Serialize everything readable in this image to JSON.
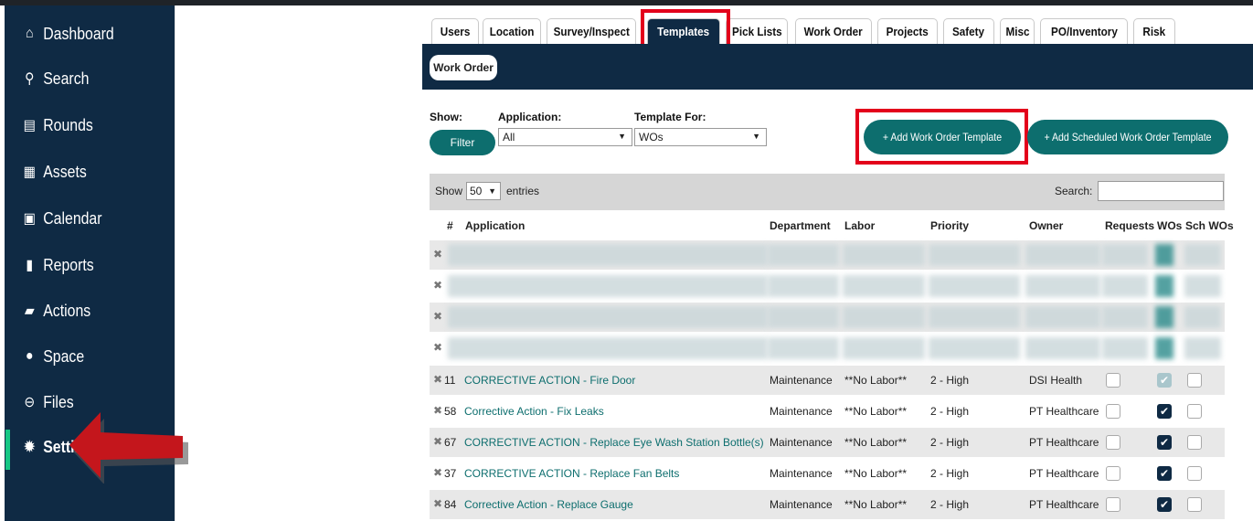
{
  "sidebar": {
    "items": [
      {
        "label": "Dashboard",
        "icon": "home-icon",
        "glyph": "⌂"
      },
      {
        "label": "Search",
        "icon": "search-icon",
        "glyph": "⚲"
      },
      {
        "label": "Rounds",
        "icon": "clipboard-icon",
        "glyph": "▤"
      },
      {
        "label": "Assets",
        "icon": "boxes-icon",
        "glyph": "▦"
      },
      {
        "label": "Calendar",
        "icon": "calendar-icon",
        "glyph": "▣"
      },
      {
        "label": "Reports",
        "icon": "bar-chart-icon",
        "glyph": "▮"
      },
      {
        "label": "Actions",
        "icon": "folder-icon",
        "glyph": "▰"
      },
      {
        "label": "Space",
        "icon": "map-pin-icon",
        "glyph": "●"
      },
      {
        "label": "Files",
        "icon": "link-icon",
        "glyph": "⊖"
      },
      {
        "label": "Settings",
        "icon": "gear-icon",
        "glyph": "✹"
      }
    ]
  },
  "tabs": [
    "Users",
    "Location",
    "Survey/Inspect",
    "Templates",
    "Pick Lists",
    "Work Order",
    "Projects",
    "Safety",
    "Misc",
    "PO/Inventory",
    "Risk"
  ],
  "active_tab": "Templates",
  "subtab": "Work Order",
  "filters": {
    "show_label": "Show:",
    "filter_button": "Filter",
    "application_label": "Application:",
    "application_value": "All",
    "template_for_label": "Template For:",
    "template_for_value": "WOs"
  },
  "buttons": {
    "add_wo_template": "+ Add Work Order Template",
    "add_scheduled_wo_template": "+ Add Scheduled Work Order Template"
  },
  "table_controls": {
    "show": "Show",
    "entries_value": "50",
    "entries": "entries",
    "search_label": "Search:"
  },
  "columns": [
    "#",
    "Application",
    "Department",
    "Labor",
    "Priority",
    "Owner",
    "Requests",
    "WOs",
    "Sch WOs"
  ],
  "rows": [
    {
      "num": "11",
      "application": "CORRECTIVE ACTION - Fire Door",
      "department": "Maintenance",
      "labor": "**No Labor**",
      "priority": "2 - High",
      "owner": "DSI Health",
      "requests": false,
      "wos": true,
      "sch_wos": false
    },
    {
      "num": "58",
      "application": "Corrective Action - Fix Leaks",
      "department": "Maintenance",
      "labor": "**No Labor**",
      "priority": "2 - High",
      "owner": "PT Healthcare",
      "requests": false,
      "wos": true,
      "sch_wos": false
    },
    {
      "num": "67",
      "application": "CORRECTIVE ACTION - Replace Eye Wash Station Bottle(s)",
      "department": "Maintenance",
      "labor": "**No Labor**",
      "priority": "2 - High",
      "owner": "PT Healthcare",
      "requests": false,
      "wos": true,
      "sch_wos": false
    },
    {
      "num": "37",
      "application": "CORRECTIVE ACTION - Replace Fan Belts",
      "department": "Maintenance",
      "labor": "**No Labor**",
      "priority": "2 - High",
      "owner": "PT Healthcare",
      "requests": false,
      "wos": true,
      "sch_wos": false
    },
    {
      "num": "84",
      "application": "Corrective Action - Replace Gauge",
      "department": "Maintenance",
      "labor": "**No Labor**",
      "priority": "2 - High",
      "owner": "PT Healthcare",
      "requests": false,
      "wos": true,
      "sch_wos": false
    }
  ],
  "colors": {
    "navy": "#0f2a44",
    "teal": "#0d6e6e",
    "highlight_red": "#e3001b",
    "active_green": "#16c784"
  }
}
